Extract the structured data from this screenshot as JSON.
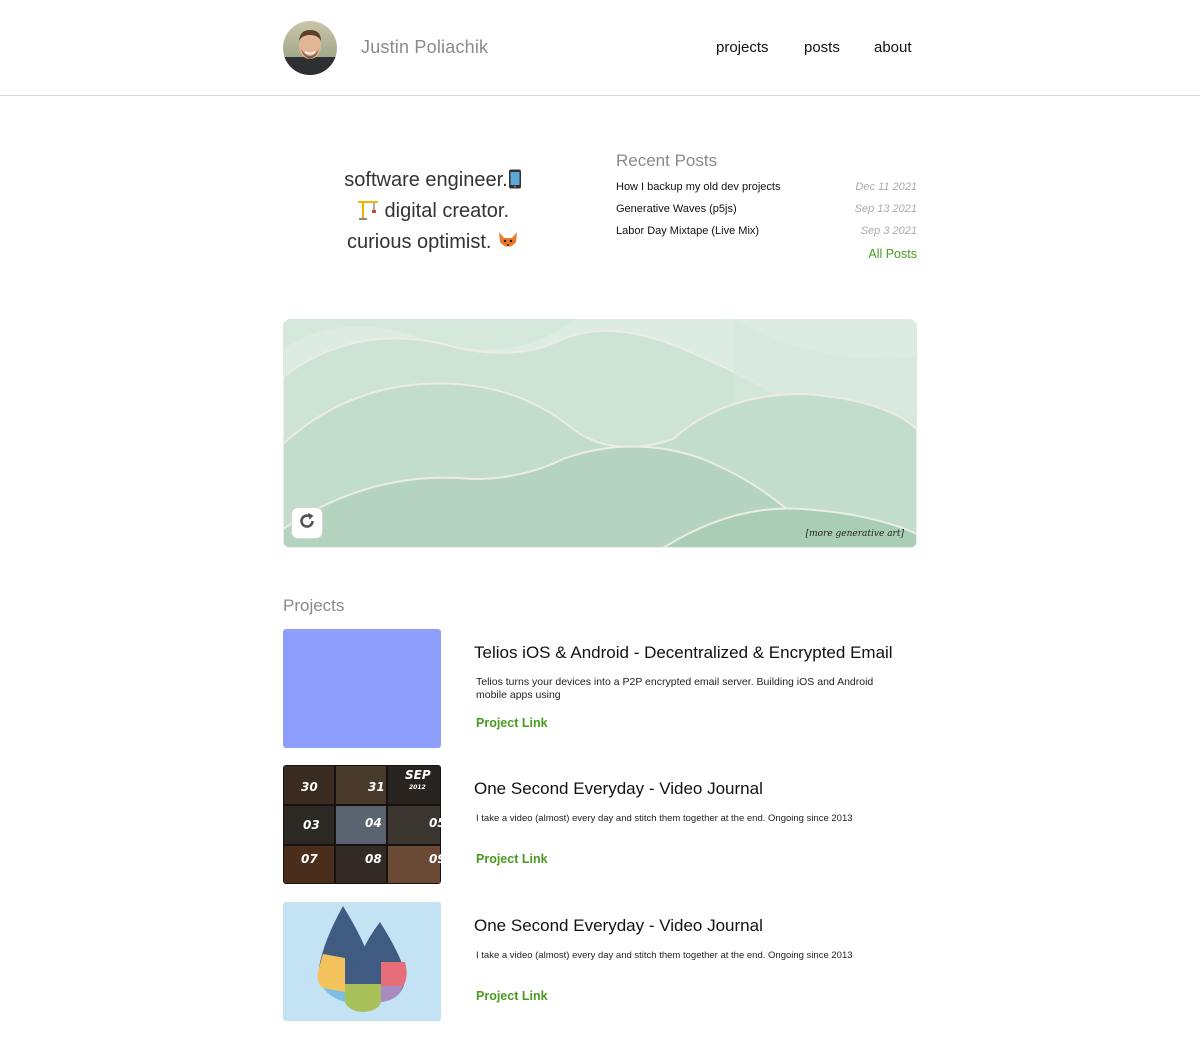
{
  "header": {
    "site_name": "Justin Poliachik",
    "nav": [
      "projects",
      "posts",
      "about"
    ]
  },
  "hero": {
    "tagline": [
      {
        "prefix": "",
        "text": "software engineer.",
        "suffix_icon": "mobile-phone-icon"
      },
      {
        "prefix_icon": "crane-icon",
        "text": " digital creator.",
        "suffix": ""
      },
      {
        "prefix": "",
        "text": "curious optimist. ",
        "suffix_icon": "fox-icon"
      }
    ]
  },
  "recent_posts": {
    "title": "Recent Posts",
    "posts": [
      {
        "title": "How I backup my old dev projects",
        "date": "Dec 11 2021"
      },
      {
        "title": "Generative Waves (p5js)",
        "date": "Sep 13 2021"
      },
      {
        "title": "Labor Day Mixtape (Live Mix)",
        "date": "Sep 3 2021"
      }
    ],
    "all_posts_label": "All Posts"
  },
  "art": {
    "caption": "[more generative art]",
    "refresh_icon": "refresh-icon",
    "colors": [
      "#dcece3",
      "#cce3d5",
      "#c2ddcb",
      "#b5d4c0",
      "#aacdb6"
    ]
  },
  "projects": {
    "title": "Projects",
    "items": [
      {
        "title": "Telios iOS & Android - Decentralized & Encrypted Email",
        "description": "Telios turns your devices into a P2P encrypted email server. Building iOS and Android mobile apps using",
        "link_label": "Project Link",
        "thumb_color": "#8d9efc"
      },
      {
        "title": "One Second Everyday - Video Journal",
        "description": "I take a video (almost) every day and stitch them together at the end. Ongoing since 2013",
        "link_label": "Project Link",
        "thumb_labels": [
          "30",
          "31",
          "SEP",
          "2012",
          "03",
          "04",
          "05",
          "07",
          "08",
          "09"
        ]
      },
      {
        "title": "One Second Everyday - Video Journal",
        "description": "I take a video (almost) every day and stitch them together at the end. Ongoing since 2013",
        "link_label": "Project Link",
        "thumb_color": "#c3e2f3"
      }
    ]
  },
  "colors": {
    "accent_green": "#4a9a1f",
    "muted_gray": "#8a8a8a"
  }
}
